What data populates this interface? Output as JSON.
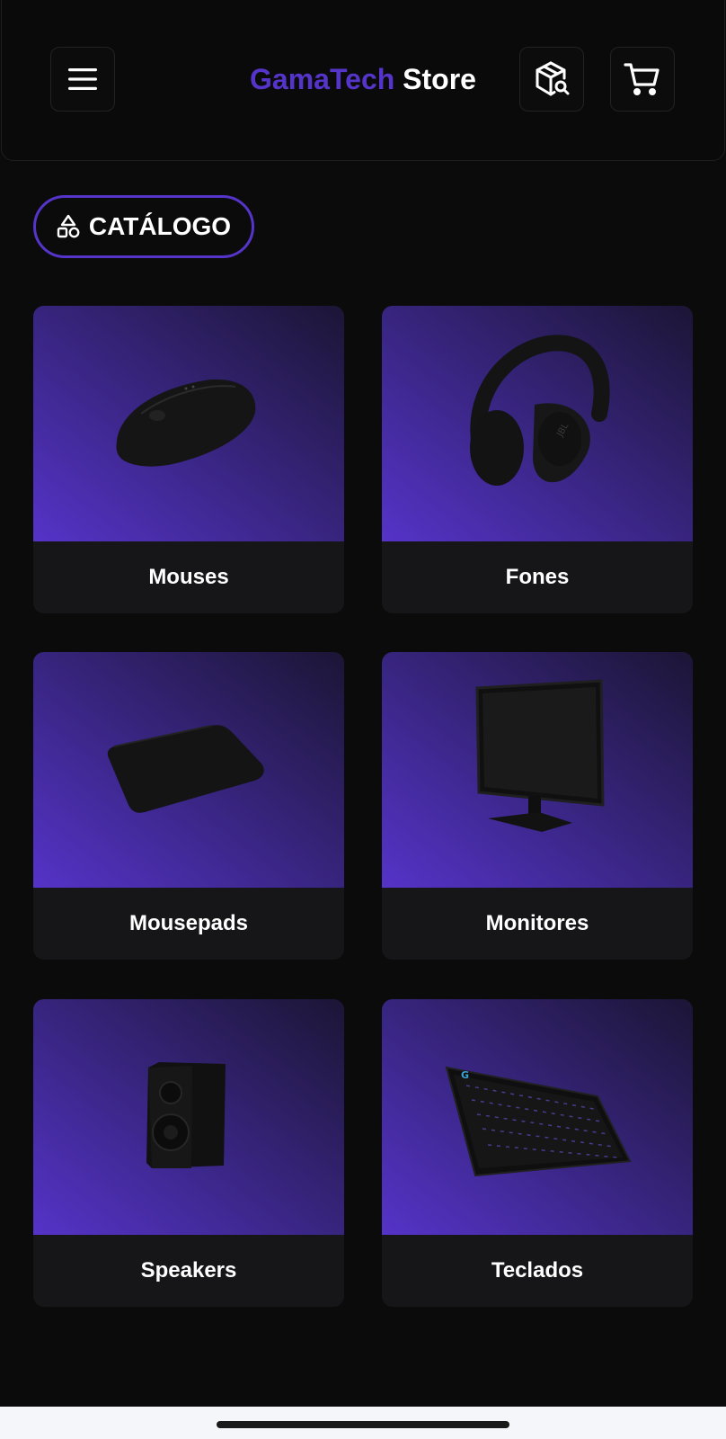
{
  "header": {
    "brand_accent": "GamaTech",
    "brand_rest": " Store",
    "menu_icon": "hamburger-menu-icon",
    "search_package_icon": "package-search-icon",
    "cart_icon": "shopping-cart-icon"
  },
  "catalog": {
    "label": "CATÁLOGO",
    "icon": "shapes-icon"
  },
  "categories": [
    {
      "label": "Mouses",
      "image": "mouse"
    },
    {
      "label": "Fones",
      "image": "headphones"
    },
    {
      "label": "Mousepads",
      "image": "mousepad"
    },
    {
      "label": "Monitores",
      "image": "monitor"
    },
    {
      "label": "Speakers",
      "image": "speaker"
    },
    {
      "label": "Teclados",
      "image": "keyboard"
    }
  ],
  "colors": {
    "accent": "#5535c9",
    "background": "#0b0b0c",
    "card": "#161618"
  }
}
